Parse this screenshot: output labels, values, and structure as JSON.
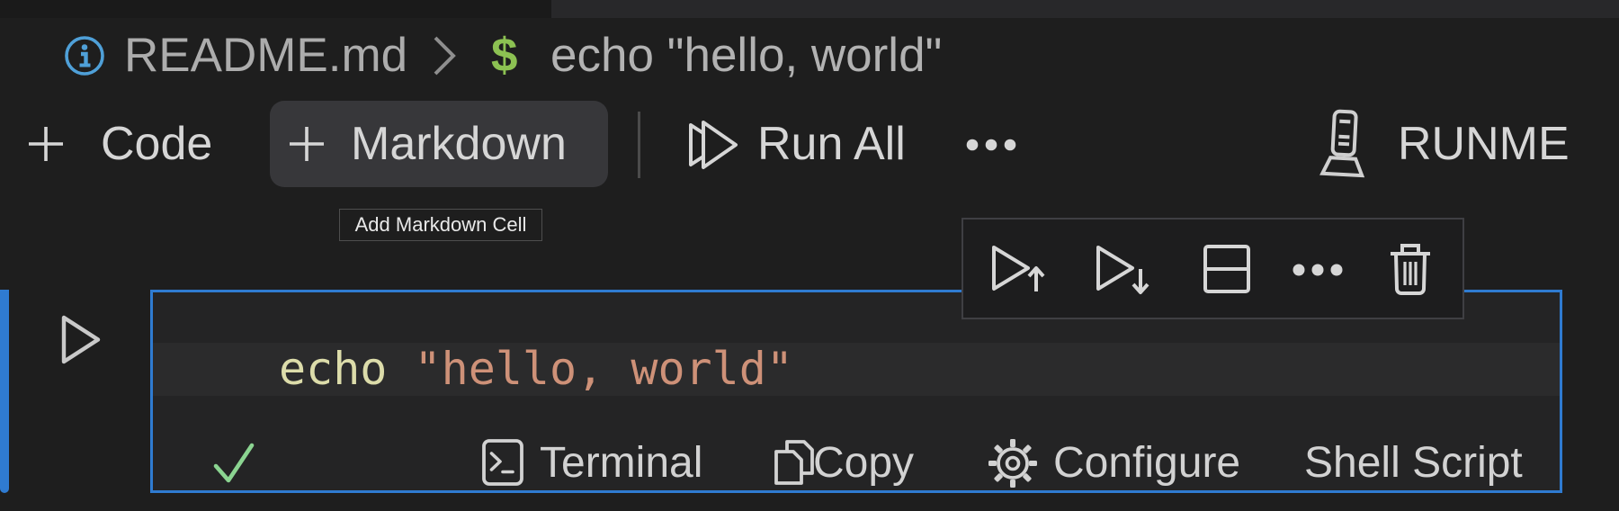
{
  "colors": {
    "accent_blue": "#2f7bd1",
    "info_blue": "#4fa0d8",
    "dollar_green": "#8cc152",
    "check_green": "#8bd491",
    "code_command_color": "#dcdcaa",
    "code_string_color": "#ce9178",
    "hover_background": "#37373a"
  },
  "breadcrumb": {
    "info_icon": "info-icon",
    "file_name": "README.md",
    "separator": "chevron-right",
    "symbol": "$",
    "command": "echo \"hello, world\""
  },
  "notebook_toolbar": {
    "code_label": "Code",
    "markdown_label": "Markdown",
    "run_all_label": "Run All",
    "more_label": "more-actions",
    "brand_label": "RUNME"
  },
  "tooltip": {
    "text": "Add Markdown Cell"
  },
  "cell_toolbar": {
    "buttons": [
      "execute-cell-and-above",
      "execute-cell-and-below",
      "split-cell",
      "more-actions",
      "delete-cell"
    ]
  },
  "cell": {
    "run_button": "play",
    "code_tokens": [
      {
        "text": "echo ",
        "color": "#dcdcaa"
      },
      {
        "text": "\"hello, world\"",
        "color": "#ce9178"
      }
    ],
    "status_bar": {
      "success_indicator": "check",
      "terminal_label": "Terminal",
      "copy_label": "Copy",
      "configure_label": "Configure",
      "language_label": "Shell Script"
    }
  }
}
